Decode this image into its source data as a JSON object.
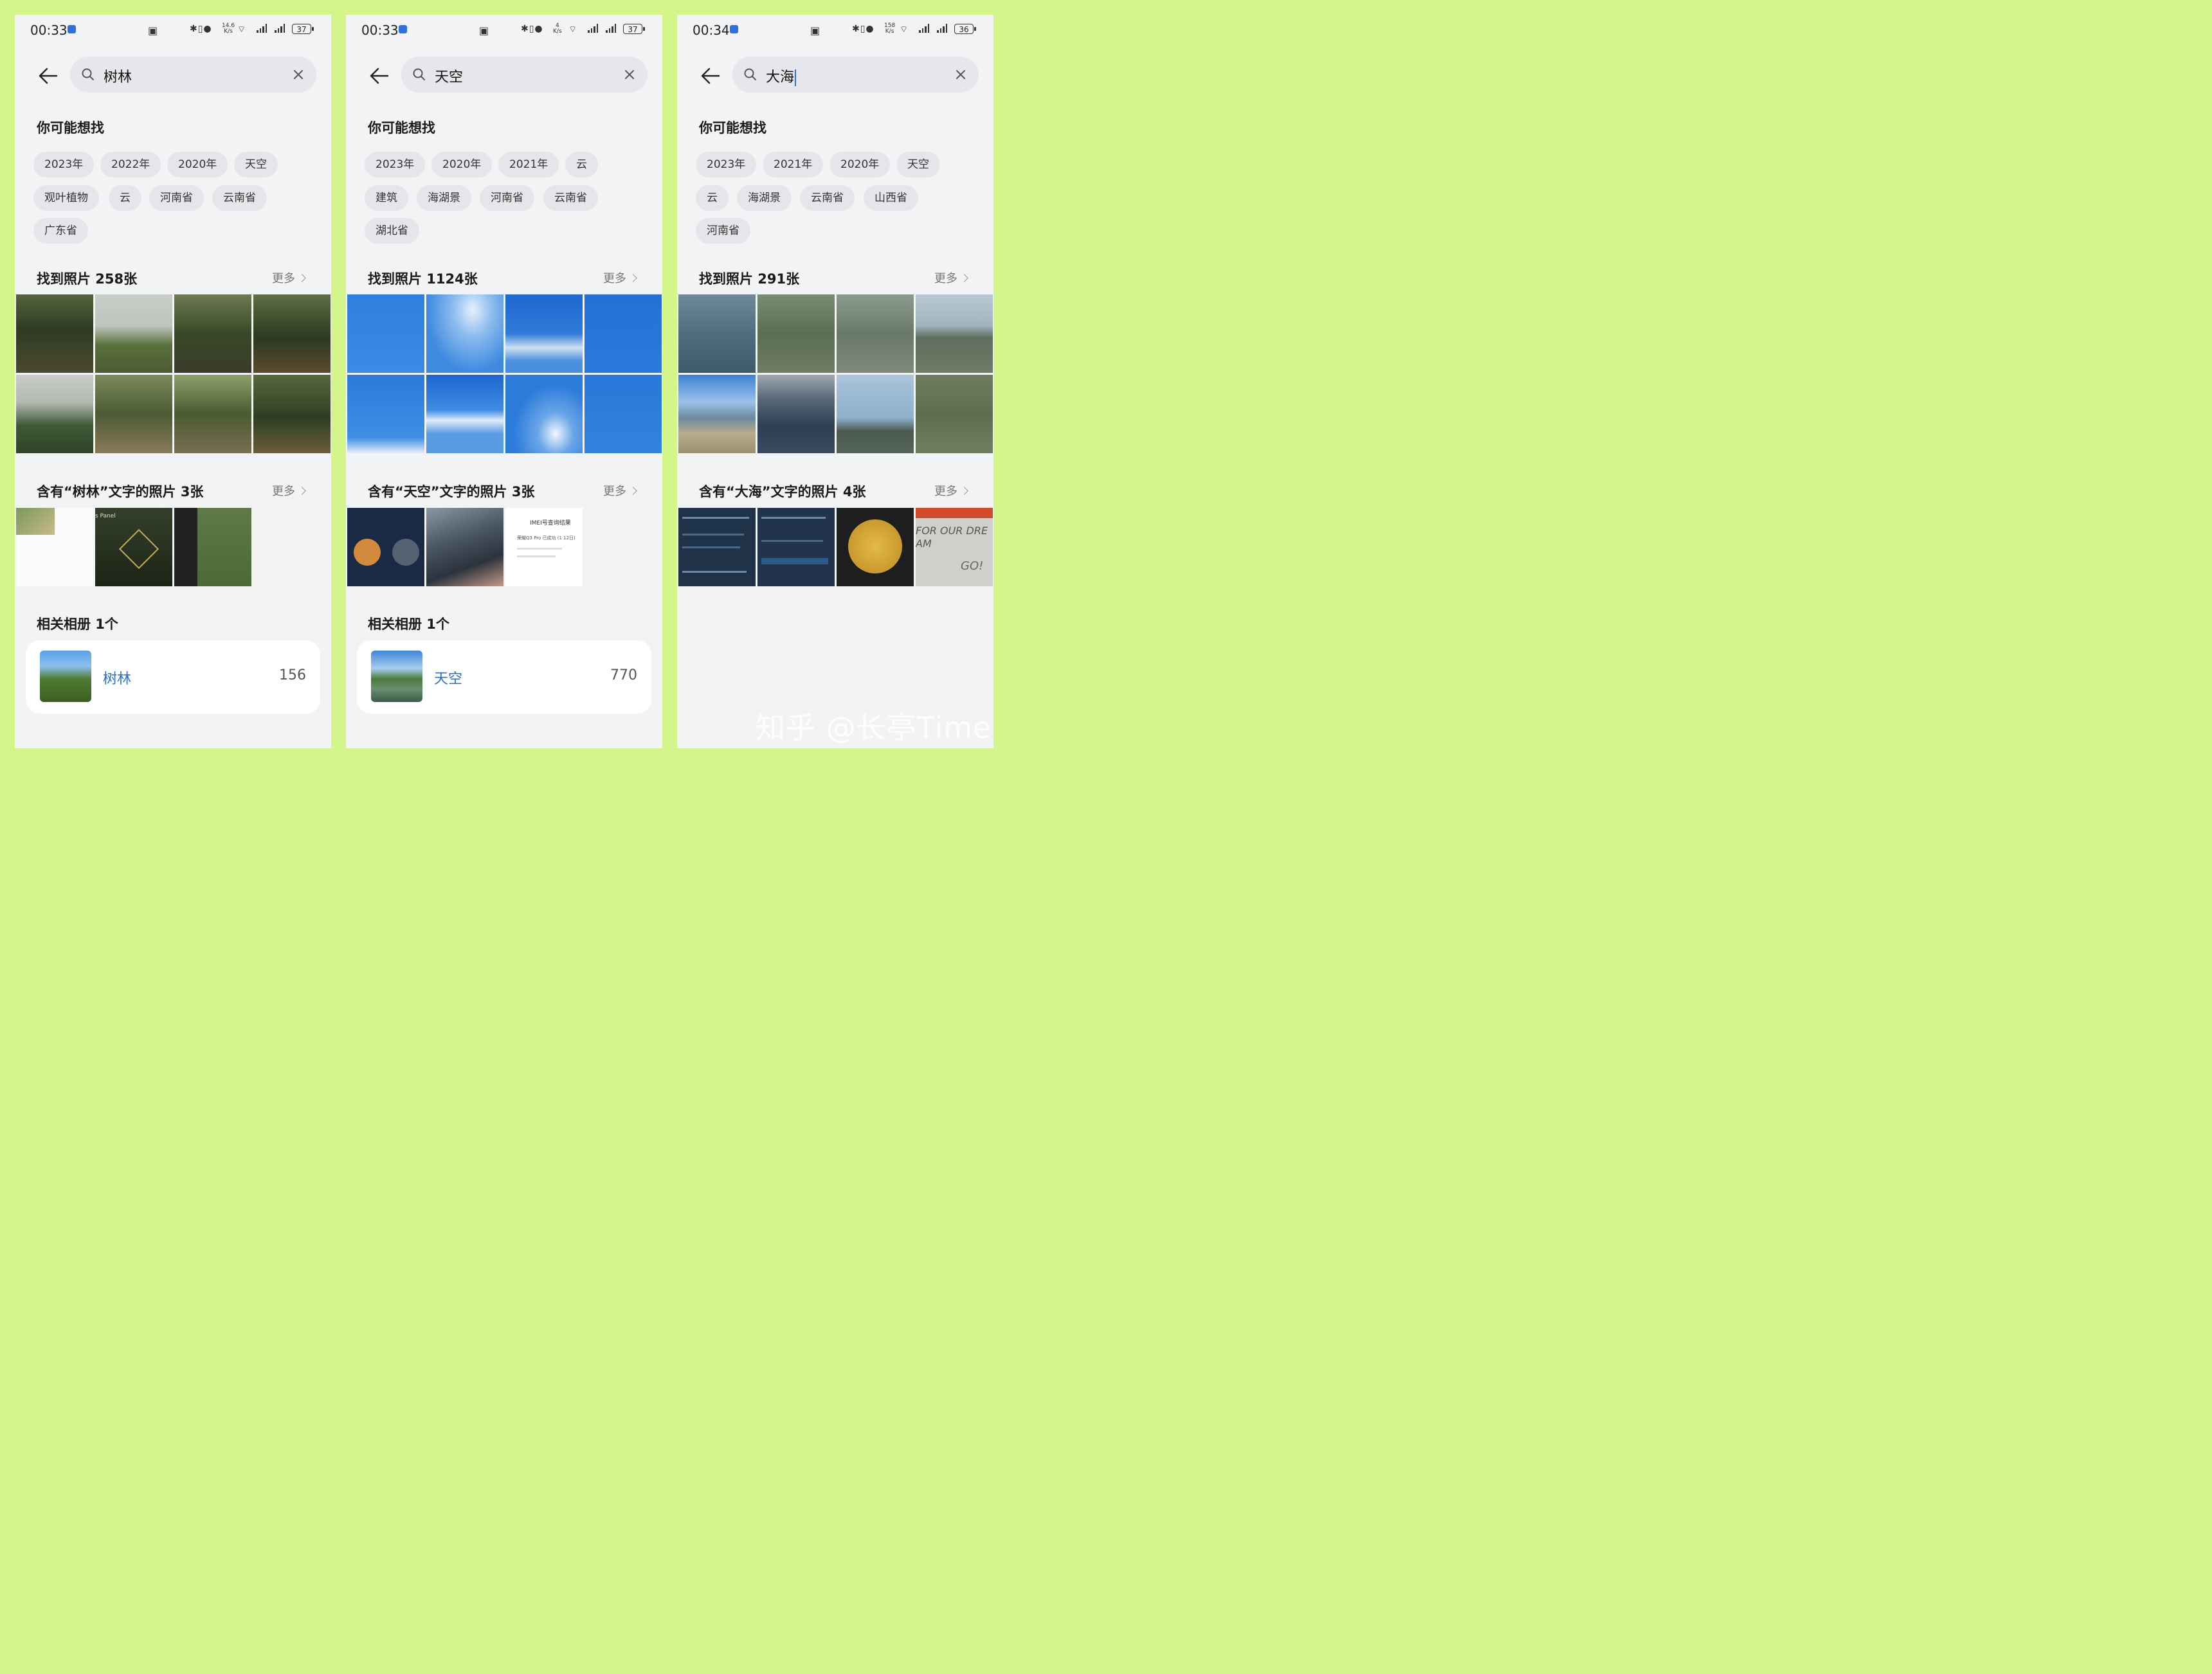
{
  "panels": [
    {
      "time": "00:33",
      "net_speed_top": "14.6",
      "net_speed_unit": "K/s",
      "battery": "37",
      "query": "树林",
      "suggest_title": "你可能想找",
      "chips": [
        "2023年",
        "2022年",
        "2020年",
        "天空",
        "观叶植物",
        "云",
        "河南省",
        "云南省",
        "广东省"
      ],
      "photos_title": "找到照片 258张",
      "more_label": "更多",
      "text_photos_title": "含有“树林”文字的照片 3张",
      "albums_title": "相关相册 1个",
      "album_name": "树林",
      "album_count": "156"
    },
    {
      "time": "00:33",
      "net_speed_top": "4",
      "net_speed_unit": "K/s",
      "battery": "37",
      "query": "天空",
      "suggest_title": "你可能想找",
      "chips": [
        "2023年",
        "2020年",
        "2021年",
        "云",
        "建筑",
        "海湖景",
        "河南省",
        "云南省",
        "湖北省"
      ],
      "photos_title": "找到照片 1124张",
      "more_label": "更多",
      "text_photos_title": "含有“天空”文字的照片 3张",
      "albums_title": "相关相册 1个",
      "album_name": "天空",
      "album_count": "770"
    },
    {
      "time": "00:34",
      "net_speed_top": "158",
      "net_speed_unit": "K/s",
      "battery": "36",
      "query": "大海",
      "suggest_title": "你可能想找",
      "chips": [
        "2023年",
        "2021年",
        "2020年",
        "天空",
        "云",
        "海湖景",
        "云南省",
        "山西省",
        "河南省"
      ],
      "photos_title": "找到照片 291张",
      "more_label": "更多",
      "text_photos_title": "含有“大海”文字的照片 4张",
      "albums_title": "",
      "album_name": "",
      "album_count": ""
    }
  ],
  "text_photo_snippets": {
    "panel1_thumb2": "s Panel",
    "panel2_thumb3_title": "IMEI号查询结果",
    "panel2_thumb3_line": "荣耀Q3 Pro 已成功 (1 12日)",
    "panel3_thumb4_line1": "FOR OUR DRE",
    "panel3_thumb4_line2": "AM",
    "panel3_thumb4_line3": "GO!"
  },
  "watermark": "知乎 @长亭Time",
  "colors": {
    "page_bg": "#d4f58a",
    "panel_bg": "#f1f3f5",
    "chip_bg": "#e4e6e9",
    "accent": "#2a6fd8",
    "forest": "#3b4a2c",
    "sky": "#2a78d8",
    "sea": "#5f7870"
  }
}
